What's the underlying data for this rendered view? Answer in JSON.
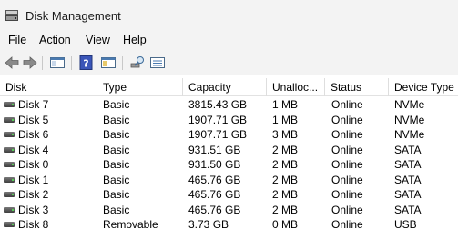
{
  "window": {
    "title": "Disk Management"
  },
  "menu": {
    "file": "File",
    "action": "Action",
    "view": "View",
    "help": "Help"
  },
  "toolbar": {
    "icons": [
      "back-arrow-icon",
      "forward-arrow-icon",
      "show-hide-console-tree-icon",
      "help-icon",
      "properties-icon",
      "rescan-icon",
      "disk-list-icon"
    ]
  },
  "columns": {
    "disk": "Disk",
    "type": "Type",
    "capacity": "Capacity",
    "unallocated": "Unalloc...",
    "status": "Status",
    "device_type": "Device Type"
  },
  "rows": [
    {
      "disk": "Disk 7",
      "type": "Basic",
      "capacity": "3815.43 GB",
      "unallocated": "1 MB",
      "status": "Online",
      "device_type": "NVMe"
    },
    {
      "disk": "Disk 5",
      "type": "Basic",
      "capacity": "1907.71 GB",
      "unallocated": "1 MB",
      "status": "Online",
      "device_type": "NVMe"
    },
    {
      "disk": "Disk 6",
      "type": "Basic",
      "capacity": "1907.71 GB",
      "unallocated": "3 MB",
      "status": "Online",
      "device_type": "NVMe"
    },
    {
      "disk": "Disk 4",
      "type": "Basic",
      "capacity": "931.51 GB",
      "unallocated": "2 MB",
      "status": "Online",
      "device_type": "SATA"
    },
    {
      "disk": "Disk 0",
      "type": "Basic",
      "capacity": "931.50 GB",
      "unallocated": "2 MB",
      "status": "Online",
      "device_type": "SATA"
    },
    {
      "disk": "Disk 1",
      "type": "Basic",
      "capacity": "465.76 GB",
      "unallocated": "2 MB",
      "status": "Online",
      "device_type": "SATA"
    },
    {
      "disk": "Disk 2",
      "type": "Basic",
      "capacity": "465.76 GB",
      "unallocated": "2 MB",
      "status": "Online",
      "device_type": "SATA"
    },
    {
      "disk": "Disk 3",
      "type": "Basic",
      "capacity": "465.76 GB",
      "unallocated": "2 MB",
      "status": "Online",
      "device_type": "SATA"
    },
    {
      "disk": "Disk 8",
      "type": "Removable",
      "capacity": "3.73 GB",
      "unallocated": "0 MB",
      "status": "Online",
      "device_type": "USB"
    }
  ]
}
